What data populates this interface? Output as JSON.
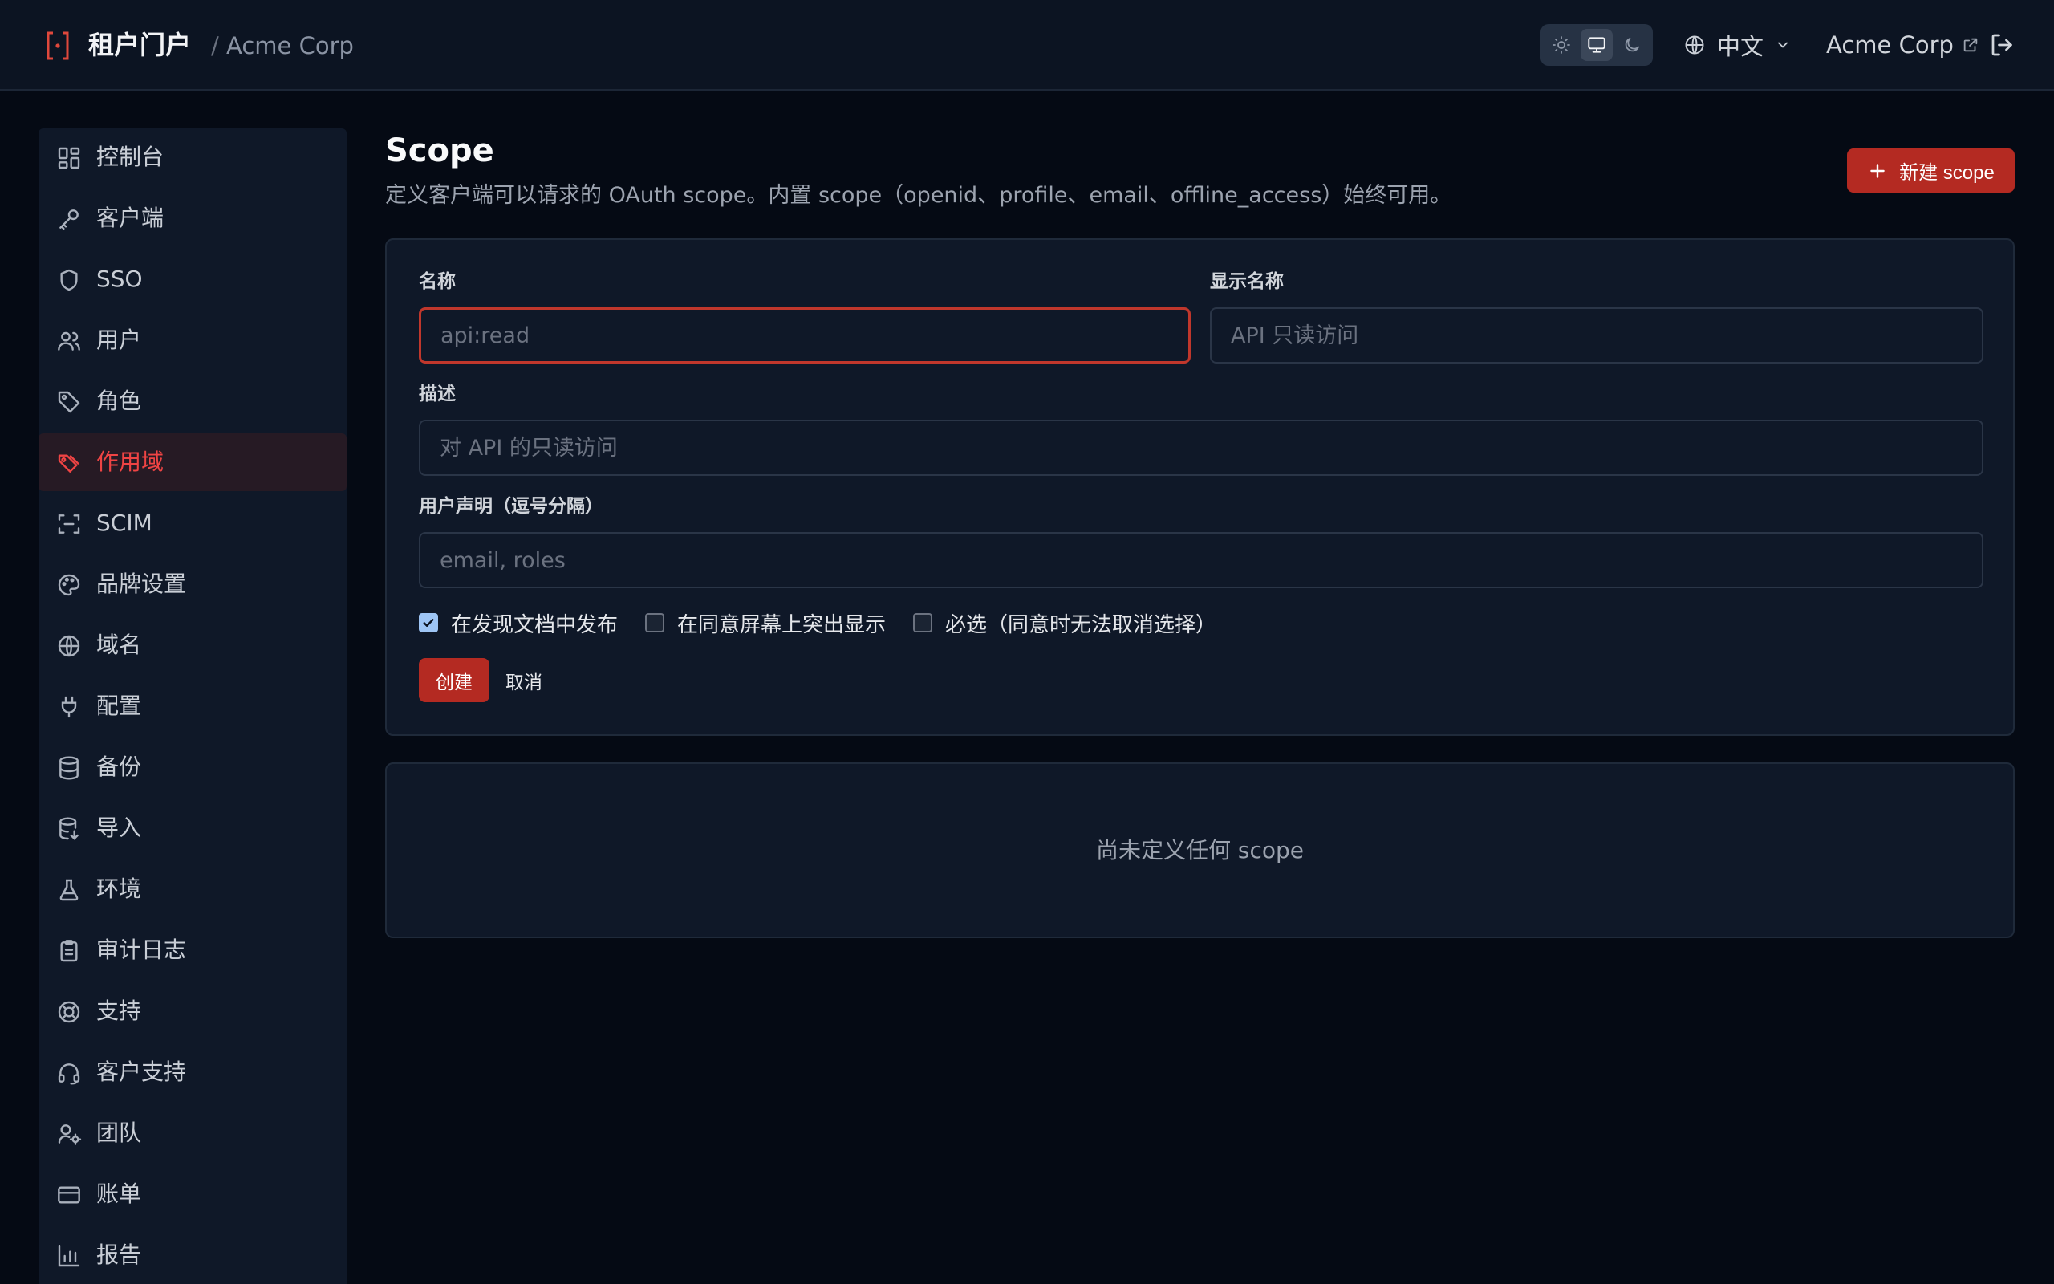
{
  "header": {
    "brand_title": "租户门户",
    "separator": "/",
    "org_name": "Acme Corp",
    "language": "中文",
    "org_link": "Acme Corp"
  },
  "sidebar": {
    "items": [
      {
        "label": "控制台",
        "icon": "dashboard-icon"
      },
      {
        "label": "客户端",
        "icon": "key-icon"
      },
      {
        "label": "SSO",
        "icon": "shield-icon"
      },
      {
        "label": "用户",
        "icon": "users-icon"
      },
      {
        "label": "角色",
        "icon": "tag-icon"
      },
      {
        "label": "作用域",
        "icon": "tags-icon",
        "active": true
      },
      {
        "label": "SCIM",
        "icon": "scan-icon"
      },
      {
        "label": "品牌设置",
        "icon": "palette-icon"
      },
      {
        "label": "域名",
        "icon": "globe-icon"
      },
      {
        "label": "配置",
        "icon": "plug-icon"
      },
      {
        "label": "备份",
        "icon": "database-icon"
      },
      {
        "label": "导入",
        "icon": "database-import-icon"
      },
      {
        "label": "环境",
        "icon": "flask-icon"
      },
      {
        "label": "审计日志",
        "icon": "clipboard-icon"
      },
      {
        "label": "支持",
        "icon": "lifebuoy-icon"
      },
      {
        "label": "客户支持",
        "icon": "headset-icon"
      },
      {
        "label": "团队",
        "icon": "user-cog-icon"
      },
      {
        "label": "账单",
        "icon": "credit-card-icon"
      },
      {
        "label": "报告",
        "icon": "bar-chart-icon"
      }
    ]
  },
  "page": {
    "title": "Scope",
    "description": "定义客户端可以请求的 OAuth scope。内置 scope（openid、profile、email、offline_access）始终可用。",
    "new_button": "新建 scope"
  },
  "form": {
    "name_label": "名称",
    "name_placeholder": "api:read",
    "display_label": "显示名称",
    "display_placeholder": "API 只读访问",
    "desc_label": "描述",
    "desc_placeholder": "对 API 的只读访问",
    "claims_label": "用户声明（逗号分隔）",
    "claims_placeholder": "email, roles",
    "check_publish": "在发现文档中发布",
    "check_publish_checked": true,
    "check_highlight": "在同意屏幕上突出显示",
    "check_highlight_checked": false,
    "check_required": "必选（同意时无法取消选择）",
    "check_required_checked": false,
    "create_button": "创建",
    "cancel_button": "取消"
  },
  "empty_state": {
    "text": "尚未定义任何 scope"
  },
  "colors": {
    "accent": "#b42a22",
    "active_nav": "#ef4444",
    "background": "#050a14",
    "panel": "#0f1828"
  }
}
